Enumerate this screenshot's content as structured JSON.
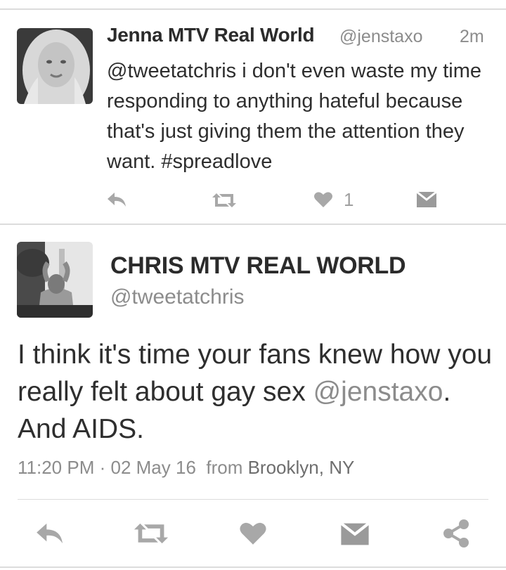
{
  "tweet1": {
    "name": "Jenna MTV Real World",
    "handle": "@jenstaxo",
    "time": "2m",
    "text": "@tweetatchris i don't even waste my time responding to anything hateful because that's just giving them the attention they want. #spreadlove",
    "actions": {
      "reply_icon": "reply-arrow",
      "retweet_icon": "retweet-arrows",
      "like_icon": "heart",
      "like_count": "1",
      "dm_icon": "envelope"
    }
  },
  "tweet2": {
    "name": "CHRIS MTV REAL WORLD",
    "handle": "@tweetatchris",
    "text_part1": "I think it's time your fans knew how you really felt about gay sex ",
    "mention": "@jenstaxo",
    "text_part2": ". And AIDS.",
    "time": "11:20 PM",
    "separator": "·",
    "date": "02 May 16",
    "from_label": "from",
    "location": "Brooklyn, NY",
    "actions": {
      "reply_icon": "reply-arrow",
      "retweet_icon": "retweet-arrows",
      "like_icon": "heart",
      "dm_icon": "envelope",
      "share_icon": "share-nodes"
    }
  },
  "colors": {
    "text": "#2e2e2e",
    "muted": "#8c8c8c",
    "icon": "#a8a8a8",
    "divider": "#dcdcdc"
  }
}
